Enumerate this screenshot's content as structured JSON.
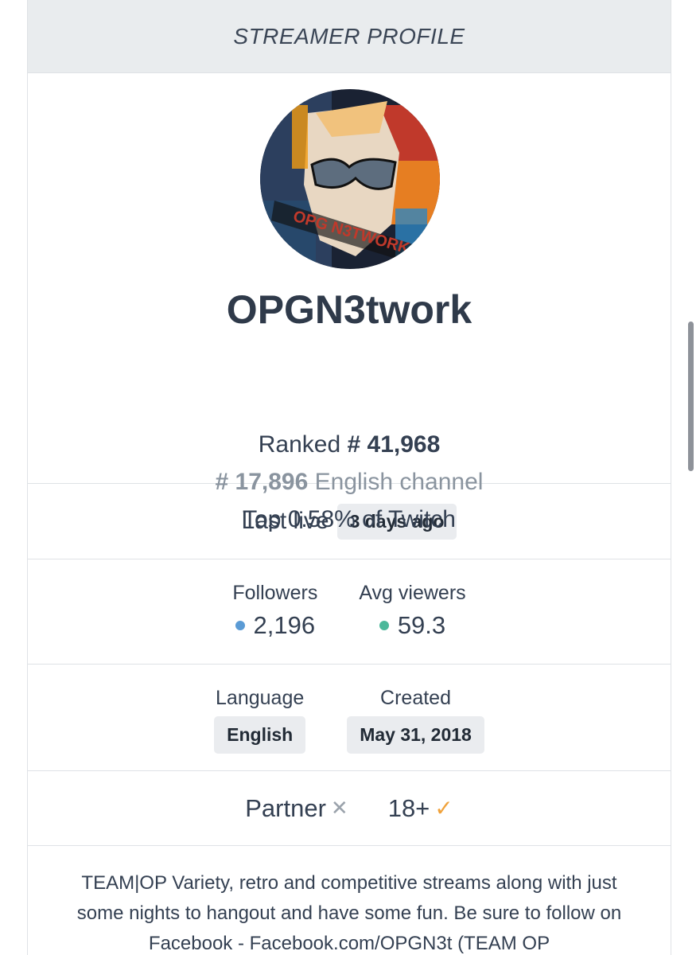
{
  "header": {
    "title": "STREAMER PROFILE"
  },
  "profile": {
    "avatar_text": "OPG N3TWORK",
    "name": "OPGN3twork",
    "rank_prefix": "Ranked",
    "rank_value": "# 41,968",
    "lang_rank_value": "# 17,896",
    "lang_rank_suffix": "English channel",
    "top_percent": "Top 0.58% of Twitch"
  },
  "last_live": {
    "label": "Last live",
    "value": "3 days ago"
  },
  "stats": {
    "followers_label": "Followers",
    "followers_value": "2,196",
    "followers_color": "#5b9bd5",
    "avg_viewers_label": "Avg viewers",
    "avg_viewers_value": "59.3",
    "avg_viewers_color": "#4bb89a"
  },
  "meta": {
    "language_label": "Language",
    "language_value": "English",
    "created_label": "Created",
    "created_value": "May 31, 2018"
  },
  "flags": {
    "partner_label": "Partner",
    "partner_icon": "x-icon",
    "mature_label": "18+",
    "mature_icon": "check-icon"
  },
  "description": "TEAM|OP Variety, retro and competitive streams along with just some nights to hangout and have some fun. Be sure to follow on Facebook - Facebook.com/OPGN3t (TEAM OP"
}
